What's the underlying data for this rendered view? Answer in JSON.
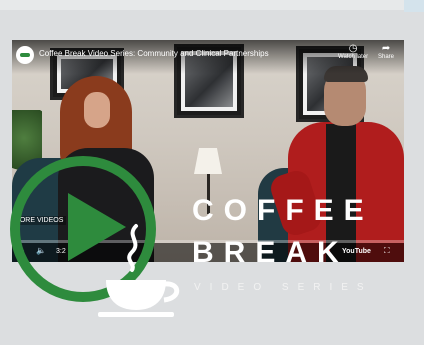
{
  "video": {
    "title": "Coffee Break Video Series: Community and Clinical Partnerships",
    "watch_later_label": "Watch later",
    "share_label": "Share",
    "more_videos_label": "MORE VIDEOS",
    "time_label": "3:2",
    "youtube_label": "YouTube",
    "progress_fraction": 0
  },
  "overlay": {
    "word1": "COFFEE",
    "word2": "BREAK",
    "subtitle": "VIDEO SERIES"
  },
  "colors": {
    "brand_green": "#2e8b3d",
    "youtube_red": "#d81f26"
  },
  "icons": {
    "channel": "coffee-break-logo-icon",
    "watch_later": "clock-icon",
    "share": "share-arrow-icon",
    "play": "play-icon",
    "volume": "volume-icon",
    "fullscreen": "fullscreen-icon",
    "big_play": "play-circle-icon",
    "cup": "coffee-cup-icon"
  }
}
